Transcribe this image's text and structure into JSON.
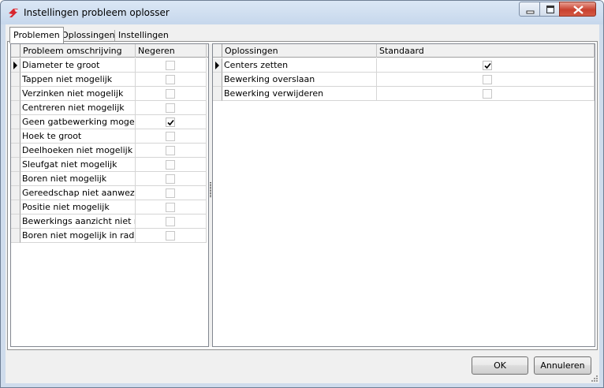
{
  "window": {
    "title": "Instellingen probleem oplosser",
    "icon": "app-logo-icon",
    "controls": [
      "minimize-icon",
      "maximize-icon",
      "close-icon"
    ]
  },
  "tabs": [
    {
      "label": "Problemen",
      "active": true
    },
    {
      "label": "Oplossingen",
      "active": false
    },
    {
      "label": "Instellingen",
      "active": false
    }
  ],
  "problems_grid": {
    "columns": [
      "Probleem omschrijving",
      "Negeren"
    ],
    "rows": [
      {
        "description": "Diameter te groot",
        "ignore": false,
        "current": true
      },
      {
        "description": "Tappen niet mogelijk",
        "ignore": false,
        "current": false
      },
      {
        "description": "Verzinken niet mogelijk",
        "ignore": false,
        "current": false
      },
      {
        "description": "Centreren niet mogelijk",
        "ignore": false,
        "current": false
      },
      {
        "description": "Geen gatbewerking mogelijk",
        "ignore": true,
        "current": false
      },
      {
        "description": "Hoek te groot",
        "ignore": false,
        "current": false
      },
      {
        "description": "Deelhoeken niet mogelijk",
        "ignore": false,
        "current": false
      },
      {
        "description": "Sleufgat niet mogelijk",
        "ignore": false,
        "current": false
      },
      {
        "description": "Boren niet mogelijk",
        "ignore": false,
        "current": false
      },
      {
        "description": "Gereedschap niet aanwezig",
        "ignore": false,
        "current": false
      },
      {
        "description": "Positie niet mogelijk",
        "ignore": false,
        "current": false
      },
      {
        "description": "Bewerkings aanzicht niet moge",
        "ignore": false,
        "current": false
      },
      {
        "description": "Boren niet mogelijk in radius pi",
        "ignore": false,
        "current": false
      }
    ]
  },
  "solutions_grid": {
    "columns": [
      "Oplossingen",
      "Standaard"
    ],
    "rows": [
      {
        "solution": "Centers zetten",
        "default": true,
        "current": true
      },
      {
        "solution": "Bewerking overslaan",
        "default": false,
        "current": false
      },
      {
        "solution": "Bewerking verwijderen",
        "default": false,
        "current": false
      }
    ]
  },
  "buttons": {
    "ok_label": "OK",
    "cancel_label": "Annuleren"
  },
  "colors": {
    "title_bar": "#c6d7ec",
    "close_button": "#c8412f",
    "app_icon": "#d8262f",
    "dialog_background": "#f0f0f0"
  }
}
